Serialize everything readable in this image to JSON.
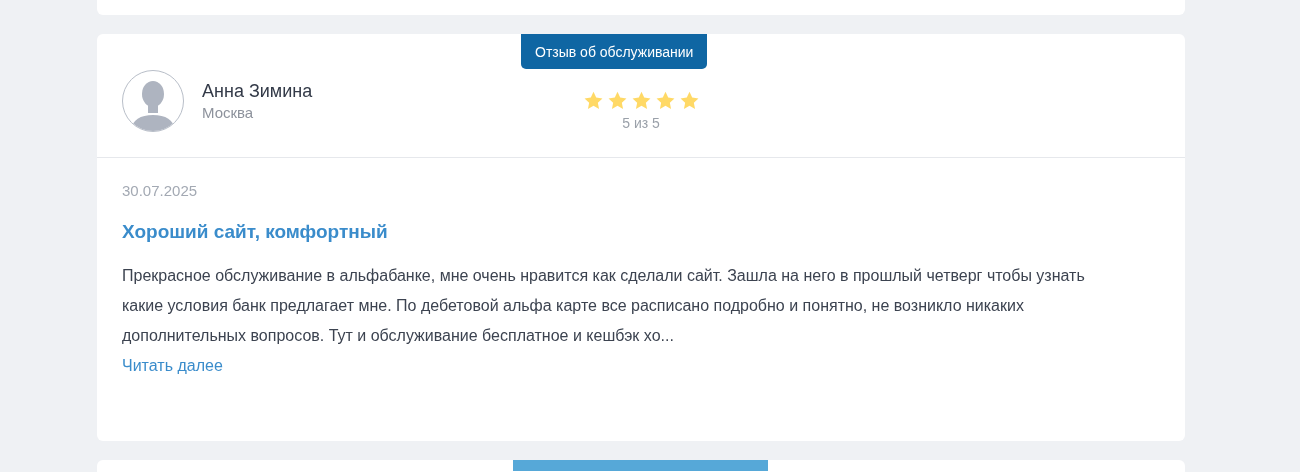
{
  "reviews": [
    {
      "kind": "full",
      "badge": "Отзыв об обслуживании",
      "author": {
        "name": "Анна Зимина",
        "city": "Москва"
      },
      "stars": 5,
      "rating_text": "5 из 5",
      "date": "30.07.2025",
      "title": "Хороший сайт, комфортный",
      "body": "Прекрасное обслуживание в альфабанке, мне очень нравится как сделали сайт. Зашла на него в прошлый четверг чтобы узнать какие условия банк предлагает мне. По дебетовой альфа карте все расписано подробно и понятно, не возникло никаких дополнительных вопросов. Тут и обслуживание бесплатное и кешбэк хо...",
      "read_more": "Читать далее"
    }
  ]
}
